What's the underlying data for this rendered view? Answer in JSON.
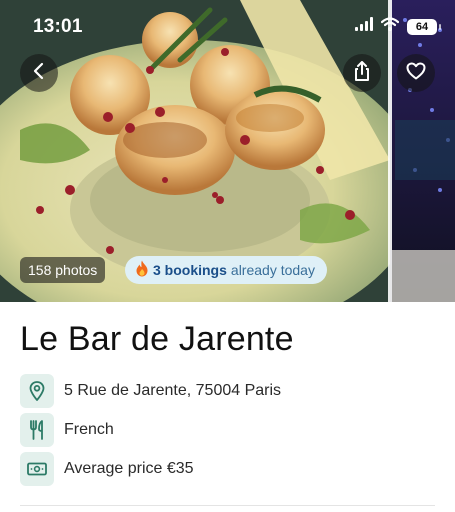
{
  "status_bar": {
    "time": "13:01",
    "battery_level": "64",
    "icons": [
      "signal-icon",
      "wifi-icon",
      "battery-icon"
    ]
  },
  "hero": {
    "photo_count": "158 photos",
    "bookings_count": "3 bookings",
    "bookings_suffix": "already today",
    "bookings_icon": "fire-icon"
  },
  "header_actions": {
    "icons": [
      "back-arrow-icon",
      "share-icon",
      "heart-icon"
    ]
  },
  "restaurant": {
    "name": "Le Bar de Jarente",
    "address": "5 Rue de Jarente, 75004 Paris",
    "cuisine": "French",
    "price": "Average price €35"
  },
  "colors": {
    "accent_teal": "#2c7a66",
    "icon_tile_bg": "#e3f0ec",
    "bookings_pill_bg": "#dff0f7",
    "bookings_text": "#1b4f8a"
  }
}
